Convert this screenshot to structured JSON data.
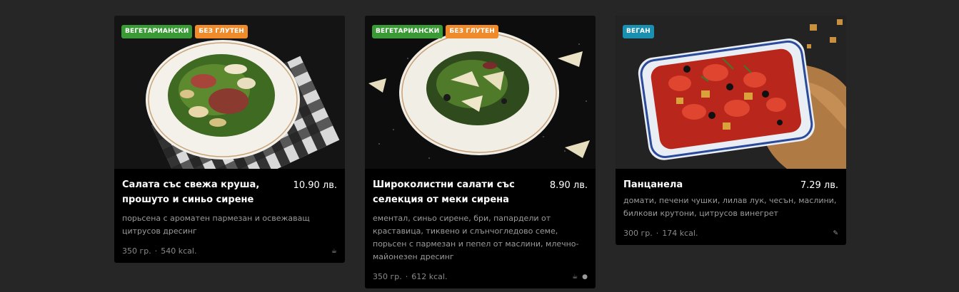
{
  "cards": [
    {
      "tags": [
        {
          "label": "ВЕГЕТАРИАНСКИ",
          "color": "#3a9a36"
        },
        {
          "label": "БЕЗ ГЛУТЕН",
          "color": "#ef8b2a"
        }
      ],
      "name": "Салата със свежа круша, прошуто и синьо сирене",
      "price": "10.90 лв.",
      "description": "порьсена с ароматен пармезан и освежаващ цитрусов дресинг",
      "weight": "350 гр.",
      "calories": "540 kcal.",
      "allergen_icons": [
        "cup-icon"
      ]
    },
    {
      "tags": [
        {
          "label": "ВЕГЕТАРИАНСКИ",
          "color": "#3a9a36"
        },
        {
          "label": "БЕЗ ГЛУТЕН",
          "color": "#ef8b2a"
        }
      ],
      "name": "Широколистни салати със селекция от меки сирена",
      "price": "8.90 лв.",
      "description": "ементал, синьо сирене, бри, папардели от краставица, тиквено и слънчогледово семе, порьсен с пармезан и пепел от маслини, млечно-майонезен дресинг",
      "weight": "350 гр.",
      "calories": "612 kcal.",
      "allergen_icons": [
        "cup-icon",
        "seed-icon"
      ]
    },
    {
      "tags": [
        {
          "label": "ВЕГАН",
          "color": "#1a8fb0"
        }
      ],
      "name": "Панцанела",
      "price": "7.29 лв.",
      "description": "домати, печени чушки, лилав лук, чесън, маслини, билкови крутони, цитрусов винегрет",
      "weight": "300 гр.",
      "calories": "174 kcal.",
      "allergen_icons": [
        "leaf-icon"
      ]
    }
  ]
}
